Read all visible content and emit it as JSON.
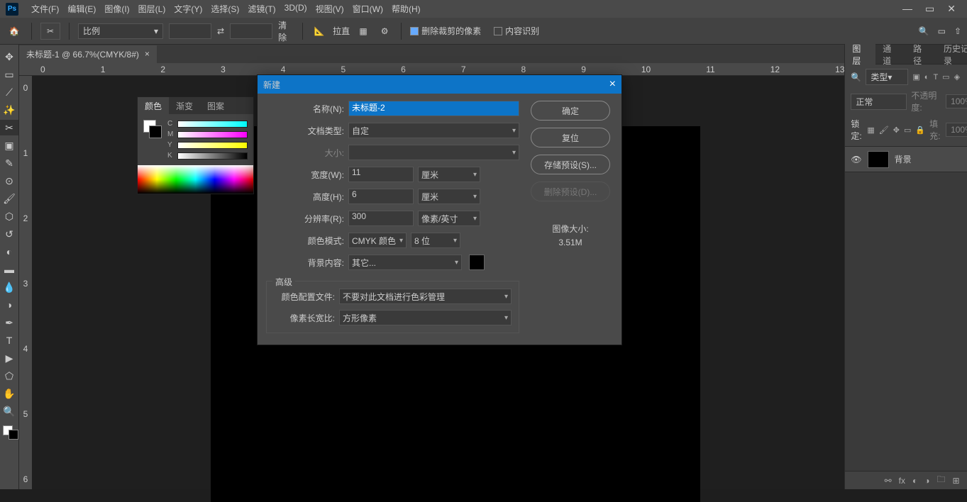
{
  "menubar": {
    "items": [
      "文件(F)",
      "编辑(E)",
      "图像(I)",
      "图层(L)",
      "文字(Y)",
      "选择(S)",
      "滤镜(T)",
      "3D(D)",
      "视图(V)",
      "窗口(W)",
      "帮助(H)"
    ]
  },
  "optionsbar": {
    "preset": "比例",
    "clear_label": "清除",
    "straighten_label": "拉直",
    "cb_delete": "删除裁剪的像素",
    "cb_content": "内容识别"
  },
  "doc": {
    "tab_title": "未标题-1 @ 66.7%(CMYK/8#)"
  },
  "ruler_h": [
    "0",
    "1",
    "2",
    "3",
    "4",
    "5",
    "6",
    "7",
    "8",
    "9",
    "10",
    "11",
    "12",
    "13"
  ],
  "ruler_v": [
    "0",
    "1",
    "2",
    "3",
    "4",
    "5",
    "6"
  ],
  "color_panel": {
    "tabs": [
      "颜色",
      "渐变",
      "图案"
    ],
    "channels": [
      "C",
      "M",
      "Y",
      "K"
    ]
  },
  "layers_panel": {
    "tabs": [
      "图层",
      "通道",
      "路径",
      "历史记录"
    ],
    "kind_label": "类型",
    "blend_mode": "正常",
    "opacity_label": "不透明度:",
    "opacity_value": "100%",
    "lock_label": "锁定:",
    "fill_label": "填充:",
    "fill_value": "100%",
    "layer_name": "背景"
  },
  "dialog": {
    "title": "新建",
    "name_label": "名称(N):",
    "name_value": "未标题-2",
    "doc_type_label": "文档类型:",
    "doc_type_value": "自定",
    "size_label": "大小:",
    "width_label": "宽度(W):",
    "width_value": "11",
    "width_unit": "厘米",
    "height_label": "高度(H):",
    "height_value": "6",
    "height_unit": "厘米",
    "res_label": "分辨率(R):",
    "res_value": "300",
    "res_unit": "像素/英寸",
    "mode_label": "颜色模式:",
    "mode_value": "CMYK 颜色",
    "mode_bit": "8 位",
    "bg_label": "背景内容:",
    "bg_value": "其它...",
    "advanced_label": "高级",
    "profile_label": "颜色配置文件:",
    "profile_value": "不要对此文档进行色彩管理",
    "aspect_label": "像素长宽比:",
    "aspect_value": "方形像素",
    "btn_ok": "确定",
    "btn_reset": "复位",
    "btn_save": "存储预设(S)...",
    "btn_delete": "删除预设(D)...",
    "size_title": "图像大小:",
    "size_value": "3.51M"
  }
}
